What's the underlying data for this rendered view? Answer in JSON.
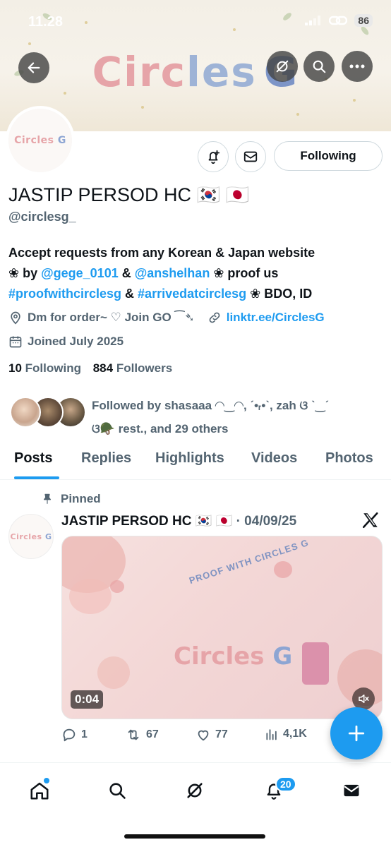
{
  "status_bar": {
    "time": "11.28",
    "battery": "86"
  },
  "banner": {
    "title_pink": "Circ",
    "title_blue": "les",
    "title_g": "G"
  },
  "profile": {
    "avatar_logo_pink": "Circles",
    "avatar_logo_blue": "G",
    "name": "JASTIP PERSOD HC 🇰🇷 🇯🇵",
    "handle": "@circlesg_",
    "following_button": "Following",
    "bio": {
      "line1": "Accept requests from any Korean & Japan website",
      "l2_a": "❀ by ",
      "l2_link1": "@gege_0101",
      "l2_b": " & ",
      "l2_link2": "@anshelhan",
      "l2_c": " ❀ proof us",
      "l3_link1": "#proofwithcirclesg",
      "l3_a": " & ",
      "l3_link2": "#arrivedatcirclesg",
      "l3_b": " ❀ BDO, ID"
    },
    "location": "Dm for order~ ♡ Join GO ⁀➴",
    "website": "linktr.ee/CirclesG",
    "joined": "Joined July 2025",
    "following_count": "10",
    "following_label": "Following",
    "followers_count": "884",
    "followers_label": "Followers",
    "followed_by_line1": "Followed by shasaaa ◠‿◠, ˊ•ᵣ•ˋ, zah ଓ ˋ‿ˊ",
    "followed_by_line2": "ଓ🪖 rest., and 29 others"
  },
  "tabs": [
    "Posts",
    "Replies",
    "Highlights",
    "Videos",
    "Photos"
  ],
  "post": {
    "pinned_label": "Pinned",
    "author": "JASTIP PERSOD HC 🇰🇷 🇯🇵",
    "date": "· 04/09/25",
    "media_arc_text": "PROOF WITH CIRCLES G",
    "media_logo_pink": "Circles",
    "media_logo_blue": "G",
    "duration": "0:04",
    "replies": "1",
    "reposts": "67",
    "likes": "77",
    "views": "4,1K"
  },
  "nav": {
    "notifications_badge": "20"
  },
  "colors": {
    "accent": "#1d9bf0",
    "text": "#0f1419",
    "muted": "#536471",
    "logo_pink": "#e6a4a8",
    "logo_blue": "#8da5d3"
  }
}
